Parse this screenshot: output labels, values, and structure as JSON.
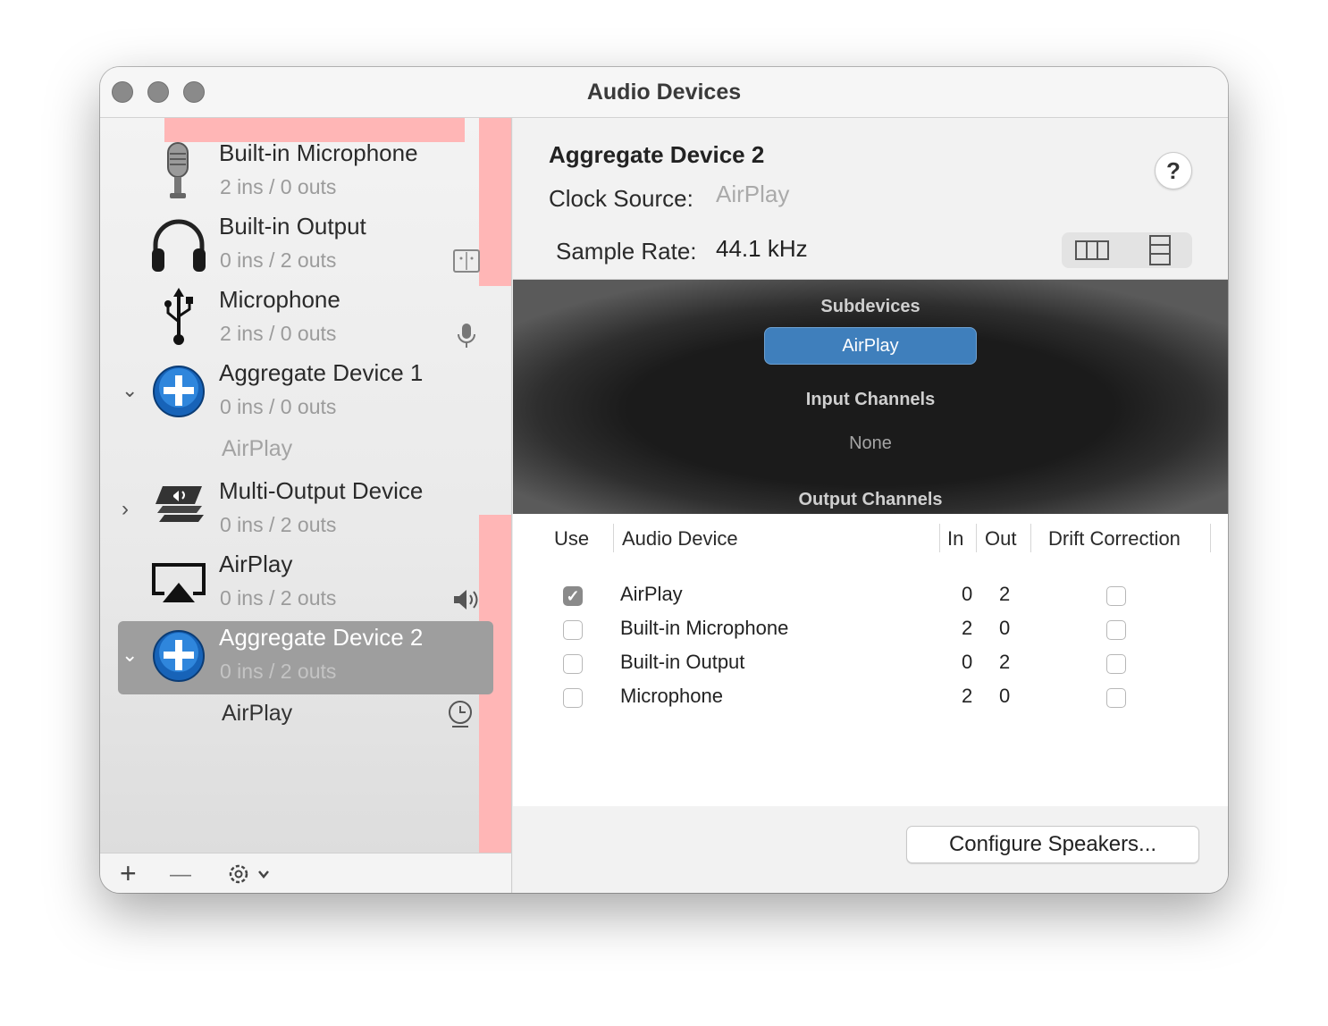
{
  "window": {
    "title": "Audio Devices"
  },
  "sidebar": {
    "devices": [
      {
        "name": "Built-in Microphone",
        "io": "2 ins / 0 outs",
        "icon": "microphone-icon"
      },
      {
        "name": "Built-in Output",
        "io": "0 ins / 2 outs",
        "icon": "headphones-icon",
        "right_icon": "finder-icon"
      },
      {
        "name": "Microphone",
        "io": "2 ins / 0 outs",
        "icon": "usb-icon",
        "right_icon": "mic-small-icon"
      },
      {
        "name": "Aggregate Device 1",
        "io": "0 ins / 0 outs",
        "icon": "aggregate-icon",
        "expanded": true,
        "subitems": [
          "AirPlay"
        ]
      },
      {
        "name": "Multi-Output Device",
        "io": "0 ins / 2 outs",
        "icon": "multi-output-icon",
        "expanded": false
      },
      {
        "name": "AirPlay",
        "io": "0 ins / 2 outs",
        "icon": "airplay-icon",
        "right_icon": "speaker-icon"
      },
      {
        "name": "Aggregate Device 2",
        "io": "0 ins / 2 outs",
        "icon": "aggregate-icon",
        "expanded": true,
        "selected": true,
        "subitems": [
          "AirPlay"
        ],
        "sub_right_icon": "clock-icon"
      }
    ],
    "footer": {
      "add": "+",
      "remove": "—"
    }
  },
  "detail": {
    "title": "Aggregate Device 2",
    "clock_source_label": "Clock Source:",
    "clock_source_value": "AirPlay",
    "sample_rate_label": "Sample Rate:",
    "sample_rate_value": "44.1 kHz",
    "help": "?",
    "subdevices_heading": "Subdevices",
    "subdevice_selected": "AirPlay",
    "input_channels_heading": "Input Channels",
    "input_channels_value": "None",
    "output_channels_heading": "Output Channels",
    "table": {
      "headers": {
        "use": "Use",
        "device": "Audio Device",
        "in": "In",
        "out": "Out",
        "drift": "Drift Correction"
      },
      "rows": [
        {
          "use": true,
          "device": "AirPlay",
          "in": "0",
          "out": "2",
          "drift": false
        },
        {
          "use": false,
          "device": "Built-in Microphone",
          "in": "2",
          "out": "0",
          "drift": false
        },
        {
          "use": false,
          "device": "Built-in Output",
          "in": "0",
          "out": "2",
          "drift": false
        },
        {
          "use": false,
          "device": "Microphone",
          "in": "2",
          "out": "0",
          "drift": false
        }
      ]
    },
    "configure_button": "Configure Speakers..."
  },
  "colors": {
    "accent": "#3f7fbc",
    "selection": "#9e9e9e",
    "debug_overlay": "#ffb6b6"
  }
}
